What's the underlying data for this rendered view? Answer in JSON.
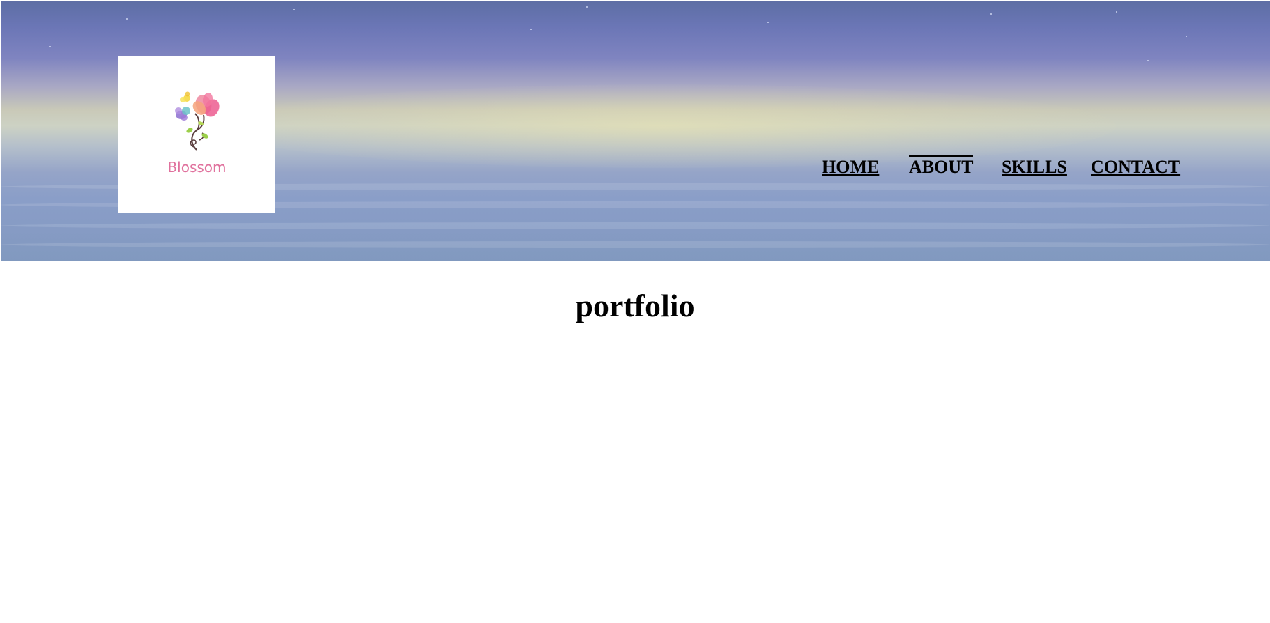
{
  "logo": {
    "text": "Blossom",
    "brand_color": "#e0719d"
  },
  "nav": {
    "items": [
      {
        "label": "HOME",
        "active": false
      },
      {
        "label": "ABOUT",
        "active": true
      },
      {
        "label": "SKILLS",
        "active": false
      },
      {
        "label": "CONTACT",
        "active": false
      }
    ]
  },
  "main": {
    "title": "portfolio"
  }
}
